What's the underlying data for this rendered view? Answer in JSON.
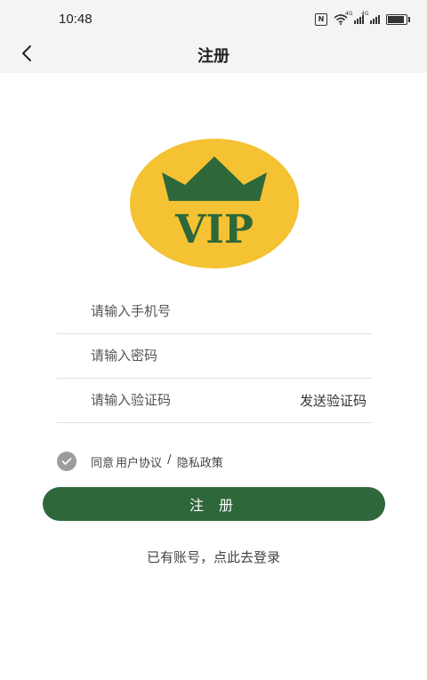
{
  "status_bar": {
    "time": "10:48",
    "network_tags": [
      "4G",
      "4G"
    ],
    "icons": [
      "nfc-icon",
      "wifi-icon",
      "signal-icon",
      "signal-icon",
      "battery-icon"
    ]
  },
  "nav": {
    "title": "注册",
    "back_icon": "chevron-left-icon"
  },
  "logo": {
    "text": "VIP",
    "circle_color": "#f4c232",
    "crown_color": "#2e673a"
  },
  "form": {
    "phone_placeholder": "请输入手机号",
    "password_placeholder": "请输入密码",
    "code_placeholder": "请输入验证码",
    "send_code_label": "发送验证码"
  },
  "agreement": {
    "prefix": "同意",
    "user_agreement": "用户协议",
    "separator": " / ",
    "privacy_policy": "隐私政策",
    "checked": true
  },
  "actions": {
    "register_label": "注 册",
    "login_label": "已有账号，点此去登录"
  },
  "colors": {
    "primary": "#2e673a",
    "accent": "#f4c232"
  }
}
